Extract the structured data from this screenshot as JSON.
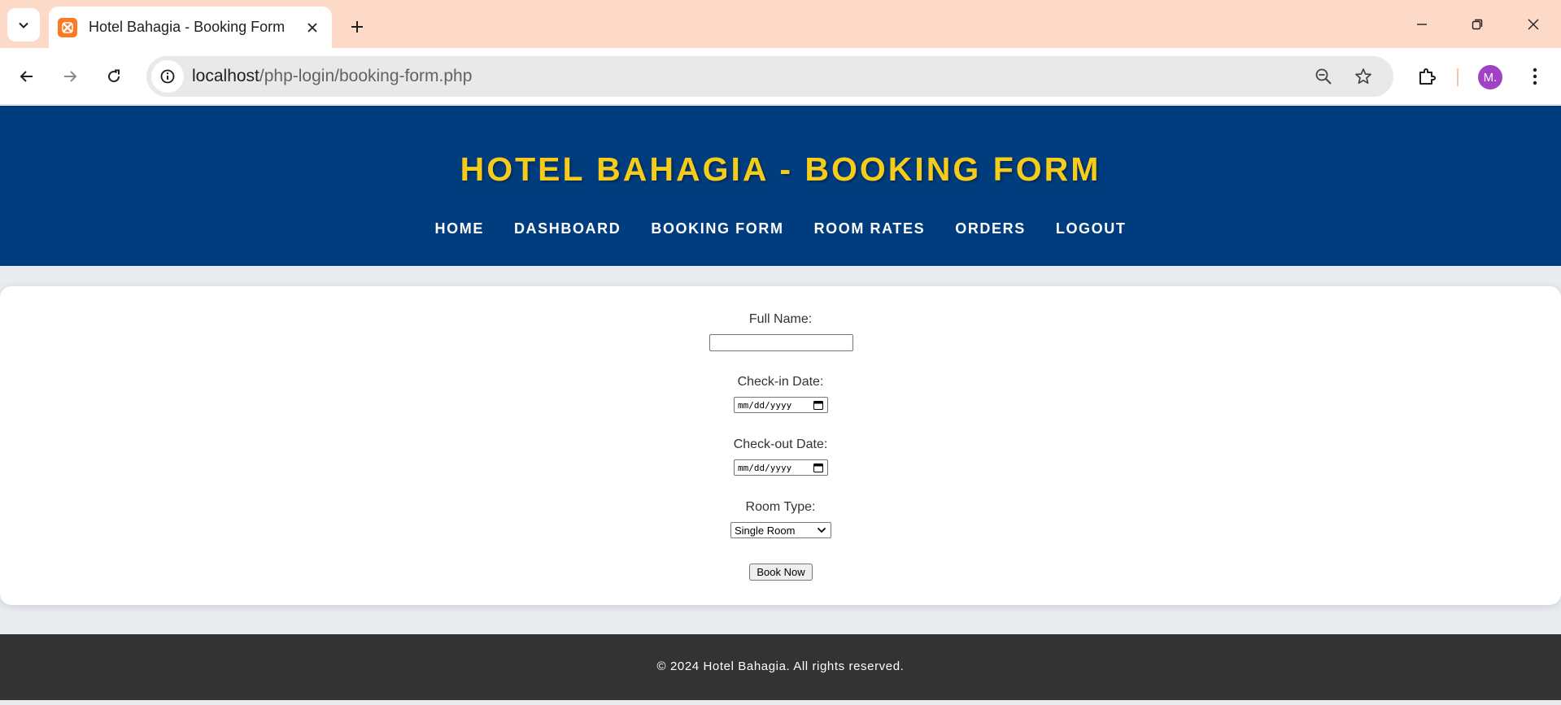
{
  "browser": {
    "tab_title": "Hotel Bahagia - Booking Form",
    "url_host": "localhost",
    "url_path": "/php-login/booking-form.php",
    "profile_initial": "M."
  },
  "header": {
    "title": "HOTEL BAHAGIA - BOOKING FORM",
    "nav": [
      "HOME",
      "DASHBOARD",
      "BOOKING FORM",
      "ROOM RATES",
      "ORDERS",
      "LOGOUT"
    ]
  },
  "form": {
    "full_name_label": "Full Name:",
    "full_name_value": "",
    "checkin_label": "Check-in Date:",
    "checkin_placeholder": "mm/dd/yyyy",
    "checkout_label": "Check-out Date:",
    "checkout_placeholder": "mm/dd/yyyy",
    "room_type_label": "Room Type:",
    "room_type_selected": "Single Room",
    "submit_label": "Book Now"
  },
  "footer": {
    "text": "© 2024 Hotel Bahagia. All rights reserved."
  },
  "colors": {
    "header_bg": "#003d7f",
    "title_color": "#f5cc1b",
    "footer_bg": "#333333",
    "tabstrip_bg": "#fddac7",
    "avatar_bg": "#a142c4"
  }
}
